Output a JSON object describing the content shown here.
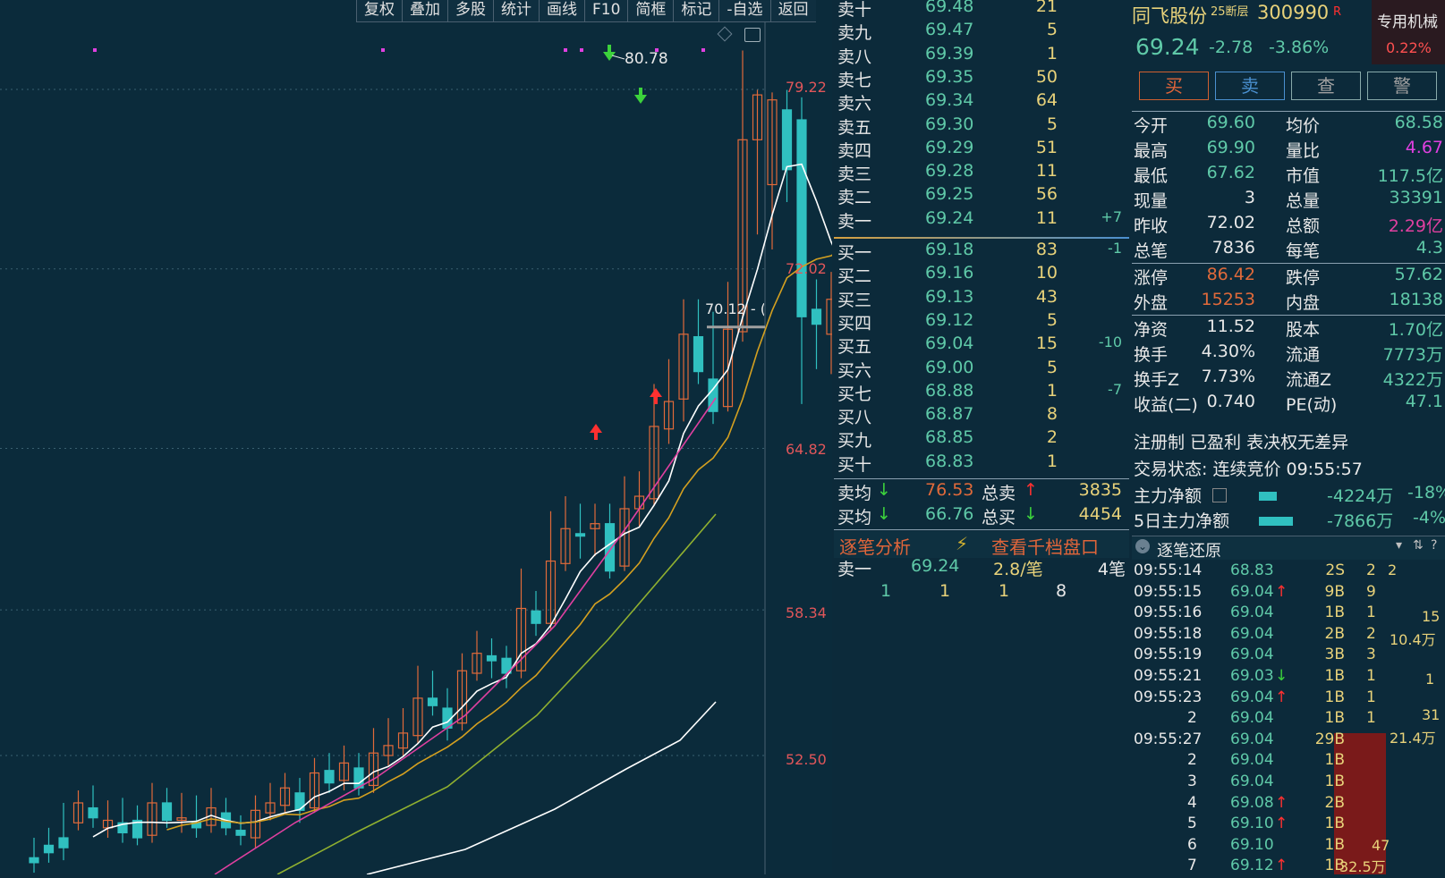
{
  "toolbar": [
    "复权",
    "叠加",
    "多股",
    "统计",
    "画线",
    "F10",
    "简框",
    "标记",
    "-自选",
    "返回"
  ],
  "chart": {
    "price_labels": [
      "79.22",
      "72.02",
      "64.82",
      "58.34",
      "52.50"
    ],
    "high_marker": "80.78",
    "current_marker": "70.12 - (",
    "colors": {
      "up": "#e06a3a",
      "down": "#30c0c0",
      "ma5": "#ffffff",
      "ma10": "#d4a020",
      "ma20": "#e040a0",
      "ma30": "#90b030",
      "ma60": "#ffffff"
    }
  },
  "orderbook": {
    "asks": [
      {
        "name": "卖十",
        "price": "69.48",
        "vol": "21",
        "chg": ""
      },
      {
        "name": "卖九",
        "price": "69.47",
        "vol": "5",
        "chg": ""
      },
      {
        "name": "卖八",
        "price": "69.39",
        "vol": "1",
        "chg": ""
      },
      {
        "name": "卖七",
        "price": "69.35",
        "vol": "50",
        "chg": ""
      },
      {
        "name": "卖六",
        "price": "69.34",
        "vol": "64",
        "chg": ""
      },
      {
        "name": "卖五",
        "price": "69.30",
        "vol": "5",
        "chg": ""
      },
      {
        "name": "卖四",
        "price": "69.29",
        "vol": "51",
        "chg": ""
      },
      {
        "name": "卖三",
        "price": "69.28",
        "vol": "11",
        "chg": ""
      },
      {
        "name": "卖二",
        "price": "69.25",
        "vol": "56",
        "chg": ""
      },
      {
        "name": "卖一",
        "price": "69.24",
        "vol": "11",
        "chg": "+7"
      }
    ],
    "bids": [
      {
        "name": "买一",
        "price": "69.18",
        "vol": "83",
        "chg": "-1"
      },
      {
        "name": "买二",
        "price": "69.16",
        "vol": "10",
        "chg": ""
      },
      {
        "name": "买三",
        "price": "69.13",
        "vol": "43",
        "chg": ""
      },
      {
        "name": "买四",
        "price": "69.12",
        "vol": "5",
        "chg": ""
      },
      {
        "name": "买五",
        "price": "69.04",
        "vol": "15",
        "chg": "-10"
      },
      {
        "name": "买六",
        "price": "69.00",
        "vol": "5",
        "chg": ""
      },
      {
        "name": "买七",
        "price": "68.88",
        "vol": "1",
        "chg": "-7"
      },
      {
        "name": "买八",
        "price": "68.87",
        "vol": "8",
        "chg": ""
      },
      {
        "name": "买九",
        "price": "68.85",
        "vol": "2",
        "chg": ""
      },
      {
        "name": "买十",
        "price": "68.83",
        "vol": "1",
        "chg": ""
      }
    ],
    "sell_avg_label": "卖均",
    "sell_avg": "76.53",
    "total_sell_label": "总卖",
    "total_sell": "3835",
    "buy_avg_label": "买均",
    "buy_avg": "66.76",
    "total_buy_label": "总买",
    "total_buy": "4454",
    "analysis_tab": "逐笔分析",
    "depth_tab": "查看千档盘口",
    "queue_label": "卖一",
    "queue_price": "69.24",
    "queue_per": "2.8/笔",
    "queue_count": "4笔",
    "queue": [
      "1",
      "1",
      "1",
      "8"
    ]
  },
  "stock": {
    "name": "同飞股份",
    "tag": "25断层",
    "code": "300990",
    "r": "R",
    "industry": "专用机械",
    "industry_pct": "0.22%",
    "price": "69.24",
    "change": "-2.78",
    "pct": "-3.86%",
    "buttons": [
      "买",
      "卖",
      "查",
      "警"
    ]
  },
  "quote": [
    {
      "l1": "今开",
      "v1": "69.60",
      "l2": "均价",
      "v2": "68.58"
    },
    {
      "l1": "最高",
      "v1": "69.90",
      "l2": "量比",
      "v2": "4.67"
    },
    {
      "l1": "最低",
      "v1": "67.62",
      "l2": "市值",
      "v2": "117.5亿"
    },
    {
      "l1": "现量",
      "v1": "3",
      "l2": "总量",
      "v2": "33391"
    },
    {
      "l1": "昨收",
      "v1": "72.02",
      "l2": "总额",
      "v2": "2.29亿"
    },
    {
      "l1": "总笔",
      "v1": "7836",
      "l2": "每笔",
      "v2": "4.3"
    },
    {
      "l1": "涨停",
      "v1": "86.42",
      "l2": "跌停",
      "v2": "57.62"
    },
    {
      "l1": "外盘",
      "v1": "15253",
      "l2": "内盘",
      "v2": "18138"
    },
    {
      "l1": "净资",
      "v1": "11.52",
      "l2": "股本",
      "v2": "1.70亿"
    },
    {
      "l1": "换手",
      "v1": "4.30%",
      "l2": "流通",
      "v2": "7773万"
    },
    {
      "l1": "换手Z",
      "v1": "7.73%",
      "l2": "流通Z",
      "v2": "4322万"
    },
    {
      "l1": "收益(二)",
      "v1": "0.740",
      "l2": "PE(动)",
      "v2": "47.1"
    }
  ],
  "notes": {
    "registration": "注册制 已盈利 表决权无差异",
    "trade_status": "交易状态: 连续竞价 09:55:57"
  },
  "main_flow": {
    "label": "主力净额",
    "value": "-4224万",
    "pct": "-18%",
    "label5": "5日主力净额",
    "value5": "-7866万",
    "pct5": "-4%"
  },
  "ticks_title": "逐笔还原",
  "ticks": [
    {
      "t": "09:55:14",
      "p": "68.83",
      "a": "",
      "v": "2S",
      "n": "2"
    },
    {
      "t": "09:55:15",
      "p": "69.04",
      "a": "↑",
      "v": "9B",
      "n": "9"
    },
    {
      "t": "09:55:16",
      "p": "69.04",
      "a": "",
      "v": "1B",
      "n": "1"
    },
    {
      "t": "09:55:18",
      "p": "69.04",
      "a": "",
      "v": "2B",
      "n": "2"
    },
    {
      "t": "09:55:19",
      "p": "69.04",
      "a": "",
      "v": "3B",
      "n": "3"
    },
    {
      "t": "09:55:21",
      "p": "69.03",
      "a": "↓",
      "v": "1B",
      "n": "1"
    },
    {
      "t": "09:55:23",
      "p": "69.04",
      "a": "↑",
      "v": "1B",
      "n": "1"
    },
    {
      "t": "2",
      "p": "69.04",
      "a": "",
      "v": "1B",
      "n": "1"
    },
    {
      "t": "09:55:27",
      "p": "69.04",
      "a": "",
      "v": "29B",
      "n": ""
    },
    {
      "t": "2",
      "p": "69.04",
      "a": "",
      "v": "1B",
      "n": ""
    },
    {
      "t": "3",
      "p": "69.04",
      "a": "",
      "v": "1B",
      "n": ""
    },
    {
      "t": "4",
      "p": "69.08",
      "a": "↑",
      "v": "2B",
      "n": ""
    },
    {
      "t": "5",
      "p": "69.10",
      "a": "↑",
      "v": "1B",
      "n": ""
    },
    {
      "t": "6",
      "p": "69.10",
      "a": "",
      "v": "1B",
      "n": ""
    },
    {
      "t": "7",
      "p": "69.12",
      "a": "↑",
      "v": "1B",
      "n": ""
    }
  ],
  "tick_side": {
    "a": "2",
    "b": "15",
    "c": "10.4万",
    "d": "1",
    "e": "31",
    "f": "21.4万",
    "g": "47",
    "h": "32.5万"
  }
}
